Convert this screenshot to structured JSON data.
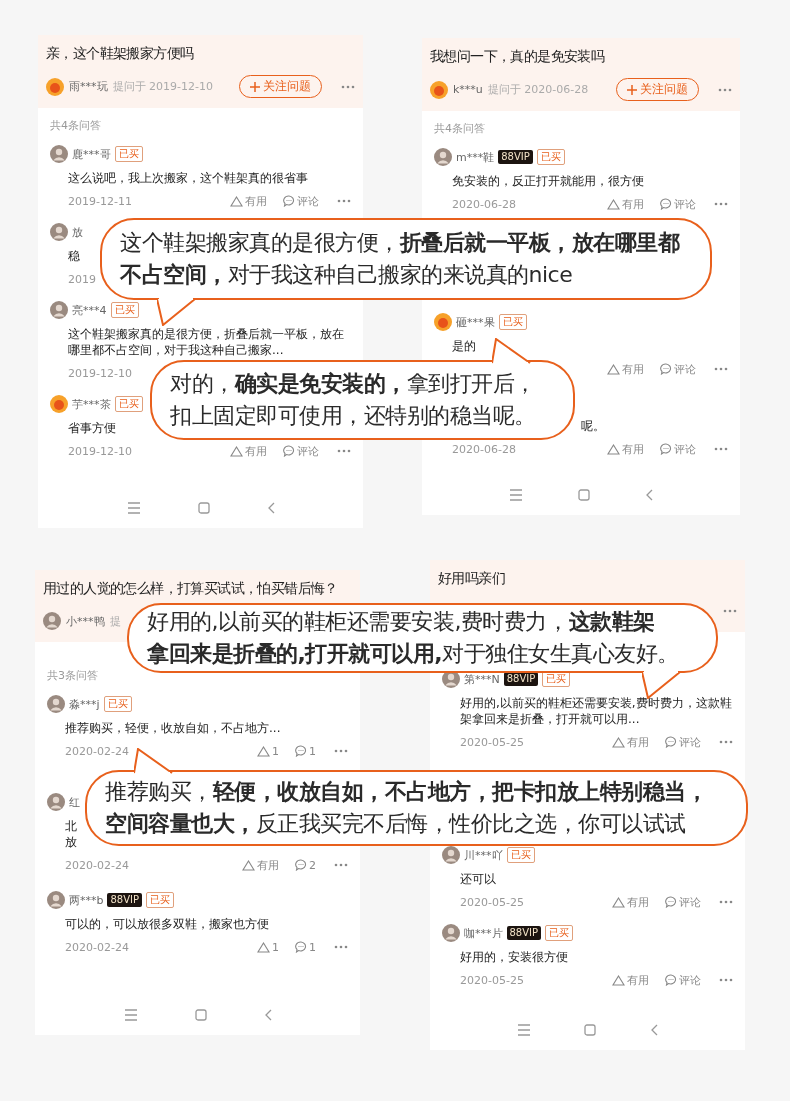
{
  "panels": [
    {
      "question": {
        "title": "亲，这个鞋架搬家方便吗",
        "avatar": {
          "kind": "mascot"
        },
        "asker": "雨***玩",
        "asked": "提问于 2019-12-10",
        "follow": "关注问题",
        "more": true
      },
      "count": "共4条问答",
      "answers": [
        {
          "avatar": {
            "kind": "photo"
          },
          "user": "鹿***哥",
          "badges": [
            {
              "kind": "bought",
              "label": "已买"
            }
          ],
          "text": "这么说吧，我上次搬家，这个鞋架真的很省事",
          "date": "2019-12-11",
          "like": "有用",
          "comment": "评论"
        },
        {
          "avatar": {
            "kind": "photo"
          },
          "user": "放",
          "text": "稳",
          "date": "2019"
        },
        {
          "avatar": {
            "kind": "photo"
          },
          "user": "亮***4",
          "badges": [
            {
              "kind": "bought",
              "label": "已买"
            }
          ],
          "text": "这个鞋架搬家真的是很方便，折叠后就一平板，放在哪里都不占空间，对于我这种自己搬家...",
          "date": "2019-12-10"
        },
        {
          "avatar": {
            "kind": "mascot"
          },
          "user": "芋***茶",
          "badges": [
            {
              "kind": "bought",
              "label": "已买"
            }
          ],
          "text": "省事方便",
          "date": "2019-12-10",
          "like": "有用",
          "comment": "评论"
        }
      ]
    },
    {
      "question": {
        "title": "我想问一下，真的是免安装吗",
        "avatar": {
          "kind": "mascot"
        },
        "asker": "k***u",
        "asked": "提问于 2020-06-28",
        "follow": "关注问题",
        "more": true
      },
      "count": "共4条问答",
      "answers": [
        {
          "avatar": {
            "kind": "photo"
          },
          "user": "m***鞋",
          "badges": [
            {
              "kind": "vip",
              "label": "88VIP"
            },
            {
              "kind": "bought",
              "label": "已买"
            }
          ],
          "text": "免安装的，反正打开就能用，很方便",
          "date": "2020-06-28",
          "like": "有用",
          "comment": "评论"
        },
        {
          "avatar": {
            "kind": "mascot"
          },
          "user": "砸***果",
          "badges": [
            {
              "kind": "bought",
              "label": "已买"
            }
          ],
          "text": "是的",
          "like": "有用",
          "comment": "评论"
        },
        {
          "kind": "clipped",
          "text": "呢。",
          "date": "2020-06-28",
          "like": "有用",
          "comment": "评论"
        }
      ]
    },
    {
      "question": {
        "title": "用过的人觉的怎么样，打算买试试，怕买错后悔？",
        "avatar": {
          "kind": "photo"
        },
        "asker": "小***鸭",
        "asked": "提"
      },
      "count": "共3条问答",
      "answers": [
        {
          "avatar": {
            "kind": "photo"
          },
          "user": "淼***j",
          "badges": [
            {
              "kind": "bought",
              "label": "已买"
            }
          ],
          "text": "推荐购买，轻便，收放自如，不占地方...",
          "date": "2020-02-24",
          "like": "1",
          "comment": "1"
        },
        {
          "kind": "stacked",
          "avatar": {
            "kind": "photo"
          },
          "user": "红",
          "text": "北放",
          "date": "2020-02-24",
          "like": "有用",
          "comment": "2"
        },
        {
          "avatar": {
            "kind": "photo"
          },
          "user": "两***b",
          "badges": [
            {
              "kind": "vip",
              "label": "88VIP"
            },
            {
              "kind": "bought",
              "label": "已买"
            }
          ],
          "text": "可以的，可以放很多双鞋，搬家也方便",
          "date": "2020-02-24",
          "like": "1",
          "comment": "1"
        }
      ]
    },
    {
      "question": {
        "title": "好用吗亲们",
        "more": true
      },
      "answers": [
        {
          "avatar": {
            "kind": "photo"
          },
          "user": "第***N",
          "badges": [
            {
              "kind": "vip",
              "label": "88VIP"
            },
            {
              "kind": "bought",
              "label": "已买"
            }
          ],
          "text": "好用的,以前买的鞋柜还需要安装,费时费力，这款鞋架拿回来是折叠，打开就可以用...",
          "date": "2020-05-25",
          "like": "有用",
          "comment": "评论"
        },
        {
          "avatar": {
            "kind": "photo"
          },
          "user": "川***吖",
          "badges": [
            {
              "kind": "bought",
              "label": "已买"
            }
          ],
          "text": "还可以",
          "date": "2020-05-25",
          "like": "有用",
          "comment": "评论"
        },
        {
          "avatar": {
            "kind": "photo"
          },
          "user": "咖***片",
          "badges": [
            {
              "kind": "vip",
              "label": "88VIP"
            },
            {
              "kind": "bought",
              "label": "已买"
            }
          ],
          "text": "好用的，安装很方便",
          "date": "2020-05-25",
          "like": "有用",
          "comment": "评论"
        }
      ]
    }
  ],
  "callouts": [
    {
      "tail": {
        "kind": "down"
      },
      "text": "这个鞋架搬家真的是很方便，**折叠后就一平板，放在哪里都不占空间，**对于我这种自己搬家的来说真的nice"
    },
    {
      "tail": {
        "kind": "up"
      },
      "text": "对的，**确实是免安装的，**拿到打开后，扣上固定即可使用，还特别的稳当呢。"
    },
    {
      "tail": {
        "kind": "down"
      },
      "lines": [
        "好用的,以前买的鞋柜还需要安装,费时费力，**这款鞋架**",
        "**拿回来是折叠的,打开就可以用,**对于独住女生真心友好。"
      ]
    },
    {
      "tail": {
        "kind": "up"
      },
      "text": "推荐购买，**轻便，收放自如，不占地方，把卡扣放上特别稳当，空间容量也大，**反正我买完不后悔，性价比之选，你可以试试"
    }
  ]
}
